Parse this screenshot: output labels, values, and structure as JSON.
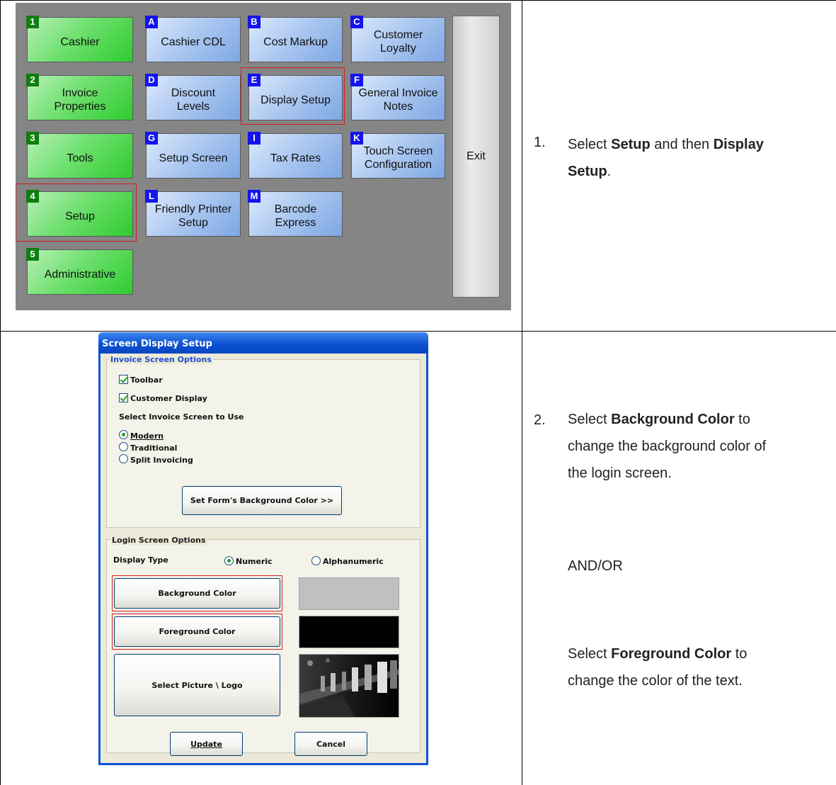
{
  "menu": {
    "tiles": [
      {
        "key": "1",
        "label": "Cashier"
      },
      {
        "key": "A",
        "label": "Cashier CDL"
      },
      {
        "key": "B",
        "label": "Cost Markup"
      },
      {
        "key": "C",
        "label": "Customer Loyalty"
      },
      {
        "key": "2",
        "label": "Invoice Properties"
      },
      {
        "key": "D",
        "label": "Discount Levels"
      },
      {
        "key": "E",
        "label": "Display Setup"
      },
      {
        "key": "F",
        "label": "General Invoice Notes"
      },
      {
        "key": "3",
        "label": "Tools"
      },
      {
        "key": "G",
        "label": "Setup Screen"
      },
      {
        "key": "I",
        "label": "Tax Rates"
      },
      {
        "key": "K",
        "label": "Touch Screen Configuration"
      },
      {
        "key": "4",
        "label": "Setup"
      },
      {
        "key": "L",
        "label": "Friendly Printer Setup"
      },
      {
        "key": "M",
        "label": "Barcode Express"
      },
      {
        "key": "5",
        "label": "Administrative"
      }
    ],
    "exit_label": "Exit",
    "colors": {
      "green_tile": "#2fcb2f",
      "blue_tile": "#a9c6f0",
      "badge_green": "#0f7d0f",
      "badge_blue": "#1414ee",
      "highlight": "#d02020"
    }
  },
  "steps": {
    "step1": {
      "number": "1.",
      "t1": "Select ",
      "b1": "Setup",
      "t2": " and then ",
      "b2": "Display",
      "b3": "Setup",
      "t3": "."
    },
    "step2": {
      "number": "2.",
      "t1": "Select ",
      "b1": "Background Color",
      "t2": " to",
      "l2": "change the background color of",
      "l3": "the login screen."
    },
    "andor": "AND/OR",
    "step3": {
      "t1": "Select ",
      "b1": "Foreground Color",
      "t2": " to",
      "l2": "change the color of the text."
    }
  },
  "dialog": {
    "title": "Screen Display Setup",
    "invoice_group": "Invoice Screen Options",
    "toolbar": "Toolbar",
    "customer_display": "Customer Display",
    "select_screen": "Select Invoice Screen to Use",
    "modern": "Modern",
    "traditional": "Traditional",
    "split": "Split Invoicing",
    "bg_form_button": "Set Form's Background Color  >>",
    "login_group": "Login Screen Options",
    "display_type": "Display Type",
    "numeric": "Numeric",
    "alphanumeric": "Alphanumeric",
    "bg_color_button": "Background Color",
    "fg_color_button": "Foreground Color",
    "picture_button": "Select Picture \\ Logo",
    "update": "Update",
    "cancel": "Cancel",
    "bg_swatch": "#c0c0c0",
    "fg_swatch": "#000000"
  }
}
